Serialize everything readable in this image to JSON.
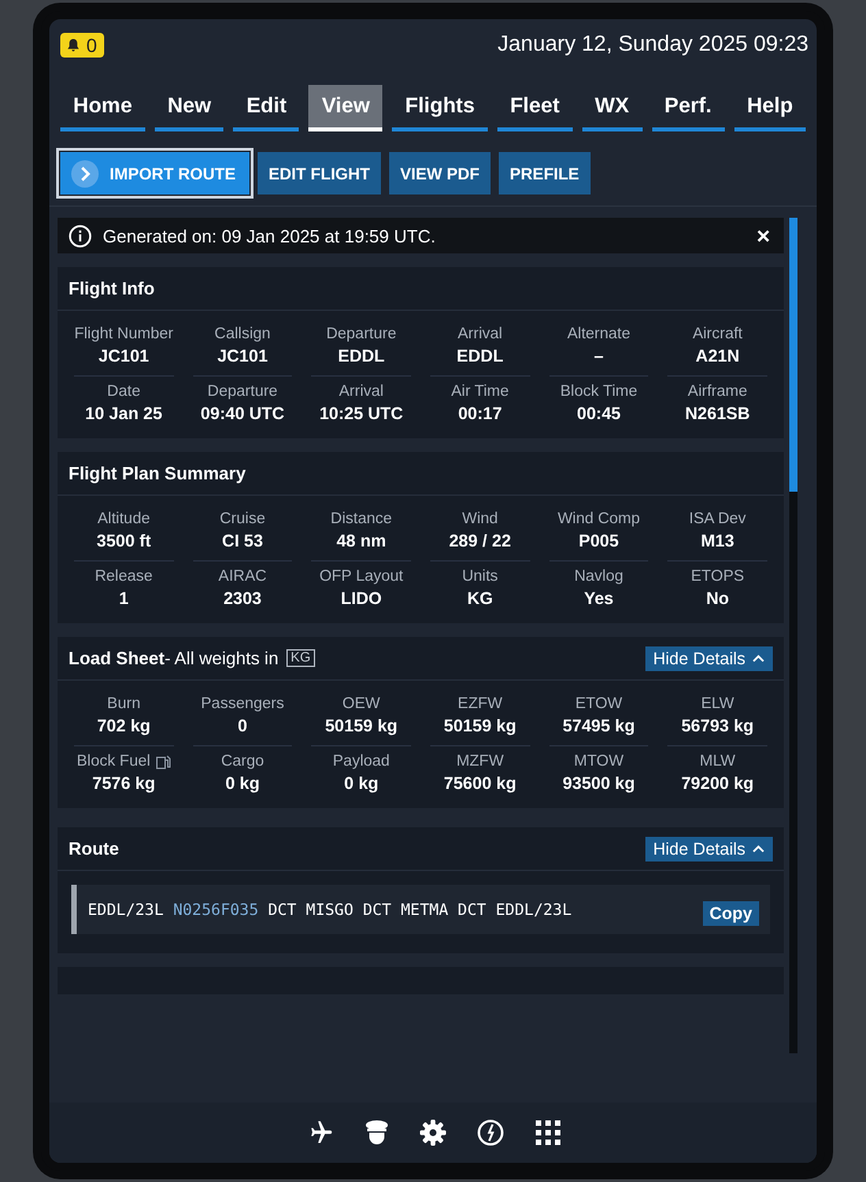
{
  "header": {
    "notification_count": "0",
    "datetime": "January 12, Sunday 2025 09:23"
  },
  "nav_tabs": [
    {
      "label": "Home",
      "selected": false
    },
    {
      "label": "New",
      "selected": false
    },
    {
      "label": "Edit",
      "selected": false
    },
    {
      "label": "View",
      "selected": true
    },
    {
      "label": "Flights",
      "selected": false
    },
    {
      "label": "Fleet",
      "selected": false
    },
    {
      "label": "WX",
      "selected": false
    },
    {
      "label": "Perf.",
      "selected": false
    },
    {
      "label": "Help",
      "selected": false
    }
  ],
  "actions": [
    {
      "label": "IMPORT ROUTE",
      "kind": "primary"
    },
    {
      "label": "EDIT FLIGHT",
      "kind": "secondary"
    },
    {
      "label": "VIEW PDF",
      "kind": "secondary"
    },
    {
      "label": "PREFILE",
      "kind": "secondary"
    }
  ],
  "notice": {
    "text": "Generated on: 09 Jan 2025 at 19:59 UTC.",
    "close": "×"
  },
  "sections": [
    {
      "title": "Flight Info",
      "rows": [
        [
          {
            "label": "Flight Number",
            "value": "JC101"
          },
          {
            "label": "Callsign",
            "value": "JC101"
          },
          {
            "label": "Departure",
            "value": "EDDL"
          },
          {
            "label": "Arrival",
            "value": "EDDL"
          },
          {
            "label": "Alternate",
            "value": "–"
          },
          {
            "label": "Aircraft",
            "value": "A21N"
          }
        ],
        [
          {
            "label": "Date",
            "value": "10 Jan 25"
          },
          {
            "label": "Departure",
            "value": "09:40 UTC"
          },
          {
            "label": "Arrival",
            "value": "10:25 UTC"
          },
          {
            "label": "Air Time",
            "value": "00:17"
          },
          {
            "label": "Block Time",
            "value": "00:45"
          },
          {
            "label": "Airframe",
            "value": "N261SB"
          }
        ]
      ]
    },
    {
      "title": "Flight Plan Summary",
      "rows": [
        [
          {
            "label": "Altitude",
            "value": "3500 ft"
          },
          {
            "label": "Cruise",
            "value": "CI 53"
          },
          {
            "label": "Distance",
            "value": "48 nm"
          },
          {
            "label": "Wind",
            "value": "289 / 22"
          },
          {
            "label": "Wind Comp",
            "value": "P005"
          },
          {
            "label": "ISA Dev",
            "value": "M13"
          }
        ],
        [
          {
            "label": "Release",
            "value": "1"
          },
          {
            "label": "AIRAC",
            "value": "2303"
          },
          {
            "label": "OFP Layout",
            "value": "LIDO"
          },
          {
            "label": "Units",
            "value": "KG"
          },
          {
            "label": "Navlog",
            "value": "Yes"
          },
          {
            "label": "ETOPS",
            "value": "No"
          }
        ]
      ]
    },
    {
      "title": "Load Sheet",
      "subtitle": "- All weights in",
      "unit": "KG",
      "toggle": "Hide Details",
      "rows": [
        [
          {
            "label": "Burn",
            "value": "702 kg"
          },
          {
            "label": "Passengers",
            "value": "0"
          },
          {
            "label": "OEW",
            "value": "50159 kg"
          },
          {
            "label": "EZFW",
            "value": "50159 kg"
          },
          {
            "label": "ETOW",
            "value": "57495 kg"
          },
          {
            "label": "ELW",
            "value": "56793 kg"
          }
        ],
        [
          {
            "label": "Block Fuel",
            "value": "7576 kg",
            "icon": true
          },
          {
            "label": "Cargo",
            "value": "0 kg"
          },
          {
            "label": "Payload",
            "value": "0 kg"
          },
          {
            "label": "MZFW",
            "value": "75600 kg"
          },
          {
            "label": "MTOW",
            "value": "93500 kg"
          },
          {
            "label": "MLW",
            "value": "79200 kg"
          }
        ]
      ]
    }
  ],
  "route": {
    "title": "Route",
    "toggle": "Hide Details",
    "copy": "Copy",
    "segments": [
      {
        "text": "EDDL/23L",
        "highlight": false
      },
      {
        "text": "N0256F035",
        "highlight": true
      },
      {
        "text": "DCT MISGO DCT METMA DCT EDDL/23L",
        "highlight": false
      }
    ]
  }
}
